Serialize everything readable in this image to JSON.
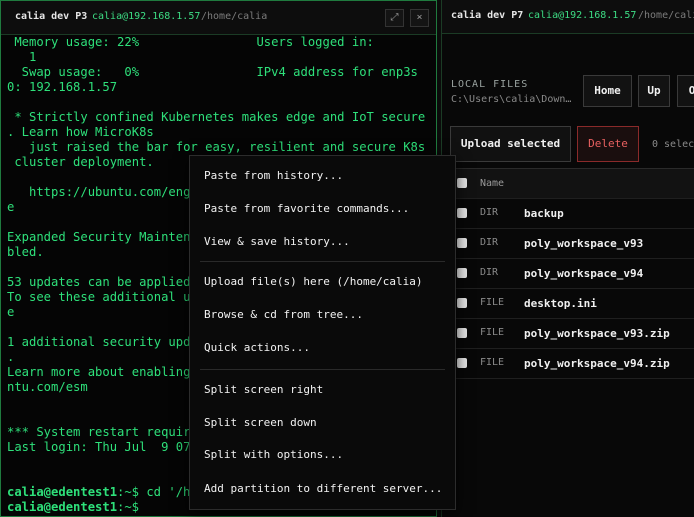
{
  "left_pane": {
    "title": "calia dev P3",
    "host": "calia@192.168.1.57",
    "path": "/home/calia",
    "expand_icon": "expand-icon",
    "close_icon": "close-icon",
    "terminal_lines": [
      " Memory usage: 22%                Users logged in:",
      "   1",
      "  Swap usage:   0%                IPv4 address for enp3s",
      "0: 192.168.1.57",
      "",
      " * Strictly confined Kubernetes makes edge and IoT secure",
      ". Learn how MicroK8s",
      "   just raised the bar for easy, resilient and secure K8s",
      " cluster deployment.",
      "",
      "   https://ubuntu.com/enga",
      "e",
      "",
      "Expanded Security Maintena",
      "bled.",
      "",
      "53 updates can be applied",
      "To see these additional up",
      "e",
      "",
      "1 additional security upda",
      ".",
      "Learn more about enabling",
      "ntu.com/esm",
      "",
      "",
      "*** System restart require",
      "Last login: Thu Jul  9 07:"
    ],
    "prompt1_user": "calia@edentest1",
    "prompt1_rest": ":~$ cd '/ho",
    "prompt2_user": "calia@edentest1",
    "prompt2_rest": ":~$"
  },
  "right_pane": {
    "title": "calia dev P7",
    "host": "calia@192.168.1.57",
    "path": "/home/calia",
    "local_files_label": "LOCAL FILES",
    "local_path": "C:\\Users\\calia\\Down…",
    "nav_home": "Home",
    "nav_up": "Up",
    "nav_more": "O",
    "upload_label": "Upload selected",
    "delete_label": "Delete",
    "selected_count": "0 selec",
    "table_header": "Name",
    "files": [
      {
        "kind": "DIR",
        "name": "backup"
      },
      {
        "kind": "DIR",
        "name": "poly_workspace_v93"
      },
      {
        "kind": "DIR",
        "name": "poly_workspace_v94"
      },
      {
        "kind": "FILE",
        "name": "desktop.ini"
      },
      {
        "kind": "FILE",
        "name": "poly_workspace_v93.zip"
      },
      {
        "kind": "FILE",
        "name": "poly_workspace_v94.zip"
      }
    ]
  },
  "context_menu": {
    "items": [
      "Paste from history...",
      "Paste from favorite commands...",
      "View & save history...",
      "Upload file(s) here (/home/calia)",
      "Browse & cd from tree...",
      "Quick actions...",
      "Split screen right",
      "Split screen down",
      "Split with options...",
      "Add partition to different server..."
    ]
  },
  "colors": {
    "terminal_green": "#2ee07a",
    "pane_border_green": "#1f7a3e",
    "delete_red": "#e86060"
  }
}
